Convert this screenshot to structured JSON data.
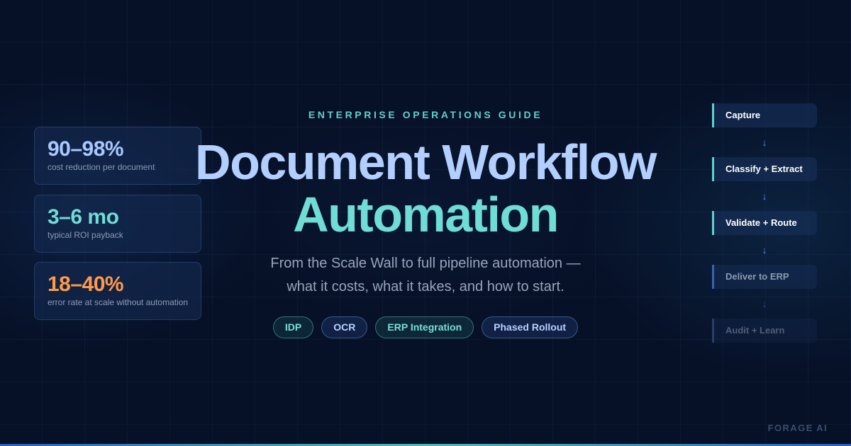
{
  "eyebrow": "ENTERPRISE OPERATIONS GUIDE",
  "title": {
    "line1": "Document Workflow",
    "line2": "Automation"
  },
  "subtitle": {
    "line1": "From the Scale Wall to full pipeline automation —",
    "line2": "what it costs, what it takes, and how to start."
  },
  "stats": [
    {
      "value": "90–98%",
      "label": "cost reduction per document",
      "color": "#a8c8ff"
    },
    {
      "value": "3–6 mo",
      "label": "typical ROI payback",
      "color": "#6fdcd6"
    },
    {
      "value": "18–40%",
      "label": "error rate at scale without automation",
      "color": "#ff9a4a"
    }
  ],
  "tags": [
    "IDP",
    "OCR",
    "ERP Integration",
    "Phased Rollout"
  ],
  "pipeline": {
    "steps": [
      "Capture",
      "Classify + Extract",
      "Validate + Route",
      "Deliver to ERP",
      "Audit + Learn"
    ],
    "arrow": "↓"
  },
  "brand": "FORAGE AI",
  "colors": {
    "background": "#061026",
    "accent_teal": "#6fdcd6",
    "accent_blue": "#b2cfff",
    "accent_orange": "#ff9a4a"
  }
}
